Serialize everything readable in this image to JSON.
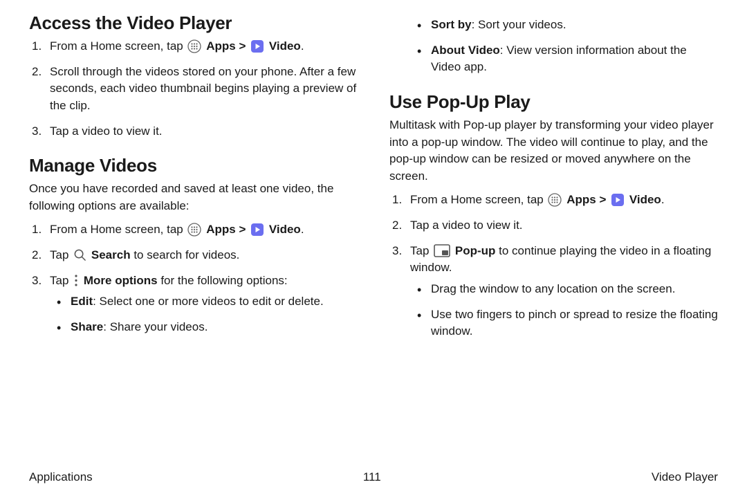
{
  "left": {
    "section1": {
      "heading": "Access the Video Player",
      "step1_prefix": "From a Home screen, tap ",
      "apps_label": "Apps",
      "separator": " > ",
      "video_label": "Video",
      "period": ".",
      "step2": "Scroll through the videos stored on your phone. After a few seconds, each video thumbnail begins playing a preview of the clip.",
      "step3": "Tap a video to view it."
    },
    "section2": {
      "heading": "Manage Videos",
      "lead": "Once you have recorded and saved at least one video, the following options are available:",
      "step1_prefix": "From a Home screen, tap ",
      "apps_label": "Apps",
      "separator": " > ",
      "video_label": "Video",
      "period": ".",
      "step2_prefix": "Tap ",
      "step2_bold": "Search",
      "step2_suffix": " to search for videos.",
      "step3_prefix": "Tap ",
      "step3_bold": "More options",
      "step3_suffix": " for the following options:",
      "bullet1_bold": "Edit",
      "bullet1_rest": ": Select one or more videos to edit or delete.",
      "bullet2_bold": "Share",
      "bullet2_rest": ": Share your videos."
    }
  },
  "right": {
    "top_bullets": {
      "b1_bold": "Sort by",
      "b1_rest": ": Sort your videos.",
      "b2_bold": "About Video",
      "b2_rest": ": View version information about the Video app."
    },
    "section3": {
      "heading": "Use Pop-Up Play",
      "lead": "Multitask with Pop-up player by transforming your video player into a pop-up window. The video will continue to play, and the pop-up window can be resized or moved anywhere on the screen.",
      "step1_prefix": "From a Home screen, tap ",
      "apps_label": "Apps",
      "separator": " > ",
      "video_label": "Video",
      "period": ".",
      "step2": "Tap a video to view it.",
      "step3_prefix": "Tap ",
      "step3_bold": "Pop-up",
      "step3_suffix": " to continue playing the video in a floating window.",
      "sub1": "Drag the window to any location on the screen.",
      "sub2": "Use two fingers to pinch or spread to resize the floating window."
    }
  },
  "footer": {
    "left": "Applications",
    "center": "111",
    "right": "Video Player"
  }
}
